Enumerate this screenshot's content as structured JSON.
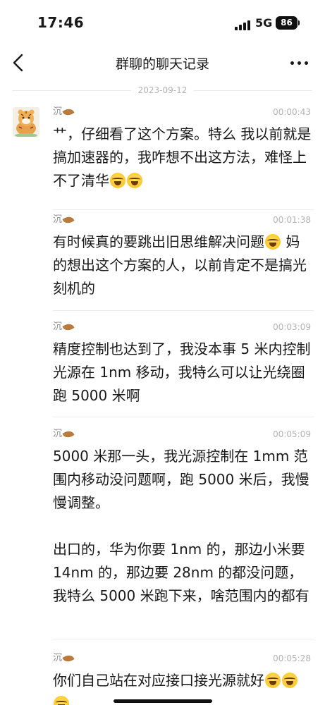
{
  "status_bar": {
    "time": "17:46",
    "network": "5G",
    "battery": "86"
  },
  "nav": {
    "title": "群聊的聊天记录",
    "back_icon": "chevron-left-icon",
    "more_icon": "more-dots-icon"
  },
  "date_separator": "2023-09-12",
  "messages": [
    {
      "sender": "沉",
      "time": "00:00:43",
      "text_before": "艹，仔细看了这个方案。特么 我以前就是搞加速器的，我咋想不出这方法，难怪上不了清华",
      "emoji_count": 2,
      "text_after": ""
    },
    {
      "sender": "沉",
      "time": "00:01:38",
      "text_before": "有时候真的要跳出旧思维解决问题",
      "emoji_count": 1,
      "text_after": " 妈的想出这个方案的人，以前肯定不是搞光刻机的"
    },
    {
      "sender": "沉",
      "time": "00:03:09",
      "text_before": "精度控制也达到了，我没本事 5 米内控制光源在 1nm 移动，我特么可以让光绕圈跑 5000 米啊",
      "emoji_count": 0,
      "text_after": ""
    },
    {
      "sender": "沉",
      "time": "00:05:09",
      "text_before": "5000 米那一头，我光源控制在 1mm 范围内移动没问题啊，跑 5000 米后，我慢慢调整。\n\n出口的，华为你要 1nm 的，那边小米要 14nm 的，那边要 28nm 的都没问题，我特么 5000 米跑下来，啥范围内的都有",
      "emoji_count": 0,
      "text_after": ""
    },
    {
      "sender": "沉",
      "time": "00:05:28",
      "text_before": "你们自己站在对应接口接光源就好",
      "emoji_count": 3,
      "text_after": ""
    }
  ],
  "colors": {
    "text": "#191919",
    "meta": "#b2b2b2",
    "divider": "#ececec",
    "leaf": "#b87a3d"
  }
}
